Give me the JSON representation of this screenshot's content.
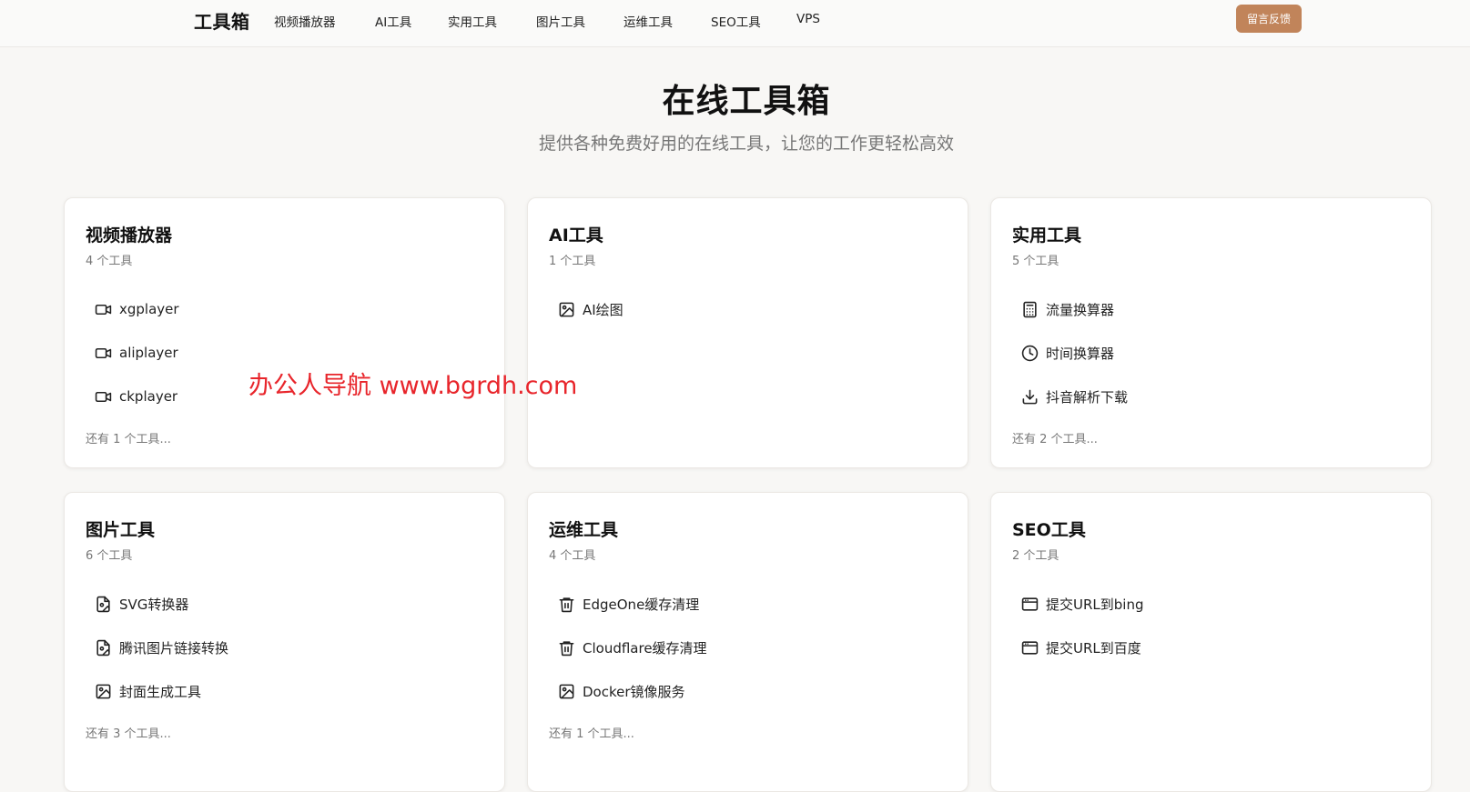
{
  "header": {
    "brand": "工具箱",
    "nav": [
      "视频播放器",
      "AI工具",
      "实用工具",
      "图片工具",
      "运维工具",
      "SEO工具",
      "VPS"
    ],
    "feedback_label": "留言反馈",
    "accent_color": "#c1845a"
  },
  "hero": {
    "title": "在线工具箱",
    "subtitle": "提供各种免费好用的在线工具，让您的工作更轻松高效"
  },
  "watermark": "办公人导航 www.bgrdh.com",
  "cards": [
    {
      "title": "视频播放器",
      "count": "4 个工具",
      "tools": [
        {
          "label": "xgplayer",
          "icon": "video-icon"
        },
        {
          "label": "aliplayer",
          "icon": "video-icon"
        },
        {
          "label": "ckplayer",
          "icon": "video-icon"
        }
      ],
      "more": "还有 1 个工具..."
    },
    {
      "title": "AI工具",
      "count": "1 个工具",
      "tools": [
        {
          "label": "AI绘图",
          "icon": "image-icon"
        }
      ],
      "more": ""
    },
    {
      "title": "实用工具",
      "count": "5 个工具",
      "tools": [
        {
          "label": "流量换算器",
          "icon": "calculator-icon"
        },
        {
          "label": "时间换算器",
          "icon": "clock-icon"
        },
        {
          "label": "抖音解析下载",
          "icon": "download-icon"
        }
      ],
      "more": "还有 2 个工具..."
    },
    {
      "title": "图片工具",
      "count": "6 个工具",
      "tools": [
        {
          "label": "SVG转换器",
          "icon": "file-image-icon"
        },
        {
          "label": "腾讯图片链接转换",
          "icon": "file-image-icon"
        },
        {
          "label": "封面生成工具",
          "icon": "image-icon"
        }
      ],
      "more": "还有 3 个工具..."
    },
    {
      "title": "运维工具",
      "count": "4 个工具",
      "tools": [
        {
          "label": "EdgeOne缓存清理",
          "icon": "trash-icon"
        },
        {
          "label": "Cloudflare缓存清理",
          "icon": "trash-icon"
        },
        {
          "label": "Docker镜像服务",
          "icon": "image-icon"
        }
      ],
      "more": "还有 1 个工具..."
    },
    {
      "title": "SEO工具",
      "count": "2 个工具",
      "tools": [
        {
          "label": "提交URL到bing",
          "icon": "browser-window-icon"
        },
        {
          "label": "提交URL到百度",
          "icon": "browser-window-icon"
        }
      ],
      "more": ""
    }
  ]
}
